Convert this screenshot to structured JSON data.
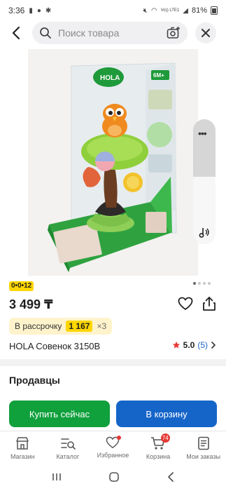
{
  "status_bar": {
    "time": "3:36",
    "network": "Vo)) LTE1",
    "battery": "81%"
  },
  "header": {
    "search_placeholder": "Поиск товара"
  },
  "product": {
    "image_alt": "HOLA Совенок 3150B",
    "box_brand": "HOLA",
    "box_age": "6M+",
    "timer": "0•0•12",
    "price": "3 499 ₸",
    "installment_label": "В рассрочку",
    "installment_amount": "1 167",
    "installment_multiplier": "×3",
    "name": "HOLA Совенок 3150B",
    "rating": "5.0",
    "rating_count": "(5)",
    "image_count": 4,
    "image_active_index": 0
  },
  "sellers": {
    "title": "Продавцы"
  },
  "actions": {
    "buy_now": "Купить сейчас",
    "add_to_cart": "В корзину"
  },
  "bottom_nav": {
    "items": [
      {
        "label": "Магазин",
        "icon": "store-icon"
      },
      {
        "label": "Каталог",
        "icon": "catalog-icon"
      },
      {
        "label": "Избранное",
        "icon": "heart-icon"
      },
      {
        "label": "Корзина",
        "icon": "cart-icon",
        "badge": "74"
      },
      {
        "label": "Мои заказы",
        "icon": "orders-icon"
      }
    ]
  },
  "colors": {
    "buy_now": "#10a03c",
    "cart": "#1565c9",
    "accent_yellow": "#ffd600",
    "badge_red": "#e53935",
    "link_blue": "#1a62c6"
  }
}
